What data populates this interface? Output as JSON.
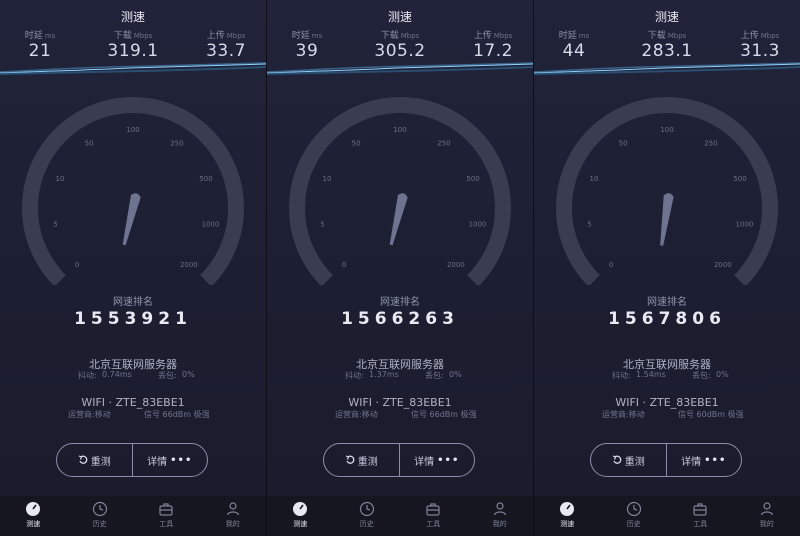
{
  "panels": [
    {
      "title": "测速",
      "metrics": [
        {
          "label": "时延",
          "unit": "ms",
          "value": "21"
        },
        {
          "label": "下载",
          "unit": "Mbps",
          "value": "319.1"
        },
        {
          "label": "上传",
          "unit": "Mbps",
          "value": "33.7"
        }
      ],
      "gauge_ticks": [
        "0",
        "5",
        "10",
        "50",
        "100",
        "250",
        "500",
        "1000",
        "2000"
      ],
      "rank_label": "网速排名",
      "rank_value": "1553921",
      "server": "北京互联网服务器",
      "jitter_label": "抖动:",
      "jitter_value": "0.74ms",
      "loss_label": "丢包:",
      "loss_value": "0%",
      "wifi": "WIFI · ZTE_83EBE1",
      "operator": "运营商:移动",
      "signal": "信号 66dBm 极强",
      "retest_label": "重测",
      "details_label": "详情",
      "needle_fraction": 0.55
    },
    {
      "title": "测速",
      "metrics": [
        {
          "label": "时延",
          "unit": "ms",
          "value": "39"
        },
        {
          "label": "下载",
          "unit": "Mbps",
          "value": "305.2"
        },
        {
          "label": "上传",
          "unit": "Mbps",
          "value": "17.2"
        }
      ],
      "gauge_ticks": [
        "0",
        "5",
        "10",
        "50",
        "100",
        "250",
        "500",
        "1000",
        "2000"
      ],
      "rank_label": "网速排名",
      "rank_value": "1566263",
      "server": "北京互联网服务器",
      "jitter_label": "抖动:",
      "jitter_value": "1.37ms",
      "loss_label": "丢包:",
      "loss_value": "0%",
      "wifi": "WIFI · ZTE_83EBE1",
      "operator": "运营商:移动",
      "signal": "信号 66dBm 极强",
      "retest_label": "重测",
      "details_label": "详情",
      "needle_fraction": 0.55
    },
    {
      "title": "测速",
      "metrics": [
        {
          "label": "时延",
          "unit": "ms",
          "value": "44"
        },
        {
          "label": "下载",
          "unit": "Mbps",
          "value": "283.1"
        },
        {
          "label": "上传",
          "unit": "Mbps",
          "value": "31.3"
        }
      ],
      "gauge_ticks": [
        "0",
        "5",
        "10",
        "50",
        "100",
        "250",
        "500",
        "1000",
        "2000"
      ],
      "rank_label": "网速排名",
      "rank_value": "1567806",
      "server": "北京互联网服务器",
      "jitter_label": "抖动:",
      "jitter_value": "1.54ms",
      "loss_label": "丢包:",
      "loss_value": "0%",
      "wifi": "WIFI · ZTE_83EBE1",
      "operator": "运营商:移动",
      "signal": "信号 60dBm 极强",
      "retest_label": "重测",
      "details_label": "详情",
      "needle_fraction": 0.53
    }
  ],
  "tabs": [
    {
      "label": "测速",
      "icon": "speedometer-icon",
      "active": true
    },
    {
      "label": "历史",
      "icon": "clock-icon",
      "active": false
    },
    {
      "label": "工具",
      "icon": "toolbox-icon",
      "active": false
    },
    {
      "label": "我的",
      "icon": "user-icon",
      "active": false
    }
  ],
  "colors": {
    "background": "#1c1e31",
    "gauge_track": "#3a3c4f",
    "wave_highlight": "#8fd3ff",
    "tabbar": "#15161f"
  }
}
